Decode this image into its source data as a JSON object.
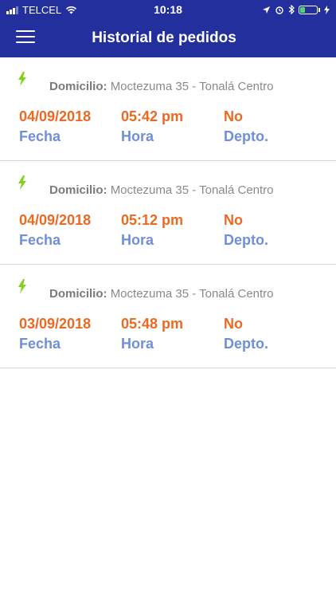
{
  "status": {
    "carrier": "TELCEL",
    "time": "10:18",
    "battery_level": 0.3
  },
  "header": {
    "title": "Historial de pedidos"
  },
  "colors": {
    "header": "#232f9c",
    "value": "#ea6a22",
    "label": "#6f8fd8",
    "bolt": "#7fd21c"
  },
  "labels": {
    "address": "Domicilio:",
    "date": "Fecha",
    "time": "Hora",
    "dept": "Depto."
  },
  "orders": [
    {
      "address": "Moctezuma 35 - Tonalá Centro",
      "date": "04/09/2018",
      "time": "05:42 pm",
      "dept": "No"
    },
    {
      "address": "Moctezuma 35 - Tonalá Centro",
      "date": "04/09/2018",
      "time": "05:12 pm",
      "dept": "No"
    },
    {
      "address": "Moctezuma 35 - Tonalá Centro",
      "date": "03/09/2018",
      "time": "05:48 pm",
      "dept": "No"
    }
  ]
}
